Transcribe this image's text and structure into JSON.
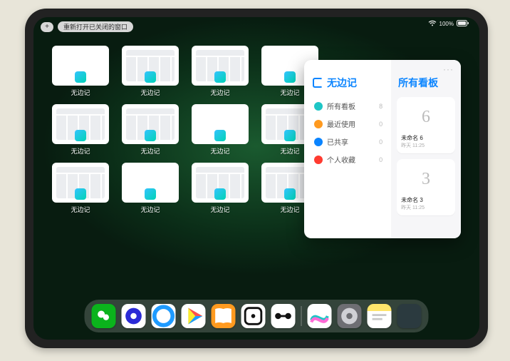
{
  "status": {
    "battery": "100%"
  },
  "topbar": {
    "plus_label": "+",
    "reopen_label": "重新打开已关闭的窗口"
  },
  "windows": [
    {
      "label": "无边记",
      "style": "blank"
    },
    {
      "label": "无边记",
      "style": "cal"
    },
    {
      "label": "无边记",
      "style": "cal"
    },
    {
      "label": "无边记",
      "style": "blank"
    },
    {
      "label": "无边记",
      "style": "cal"
    },
    {
      "label": "无边记",
      "style": "cal"
    },
    {
      "label": "无边记",
      "style": "blank"
    },
    {
      "label": "无边记",
      "style": "cal"
    },
    {
      "label": "无边记",
      "style": "cal"
    },
    {
      "label": "无边记",
      "style": "blank"
    },
    {
      "label": "无边记",
      "style": "cal"
    },
    {
      "label": "无边记",
      "style": "cal"
    }
  ],
  "panel": {
    "left_title": "无边记",
    "right_title": "所有看板",
    "nav": [
      {
        "label": "所有看板",
        "count": "8",
        "color": "#1ec6c6"
      },
      {
        "label": "最近使用",
        "count": "0",
        "color": "#ff9a1f"
      },
      {
        "label": "已共享",
        "count": "0",
        "color": "#0a84ff"
      },
      {
        "label": "个人收藏",
        "count": "0",
        "color": "#ff3b30"
      }
    ],
    "boards": [
      {
        "glyph": "6",
        "title": "未命名 6",
        "subtitle": "昨天 11:25"
      },
      {
        "glyph": "3",
        "title": "未命名 3",
        "subtitle": "昨天 11:25"
      }
    ],
    "more": "···"
  },
  "dock": [
    {
      "name": "wechat",
      "cls": "i-wechat"
    },
    {
      "name": "quark",
      "cls": "i-quark"
    },
    {
      "name": "qqbrowser",
      "cls": "i-qq"
    },
    {
      "name": "play",
      "cls": "i-play"
    },
    {
      "name": "books",
      "cls": "i-books"
    },
    {
      "name": "dice",
      "cls": "i-dice"
    },
    {
      "name": "barbell",
      "cls": "i-bbb"
    },
    {
      "name": "sep"
    },
    {
      "name": "freeform",
      "cls": "i-free"
    },
    {
      "name": "settings",
      "cls": "i-set"
    },
    {
      "name": "notes",
      "cls": "i-notes"
    },
    {
      "name": "applib",
      "cls": "i-multi"
    }
  ]
}
